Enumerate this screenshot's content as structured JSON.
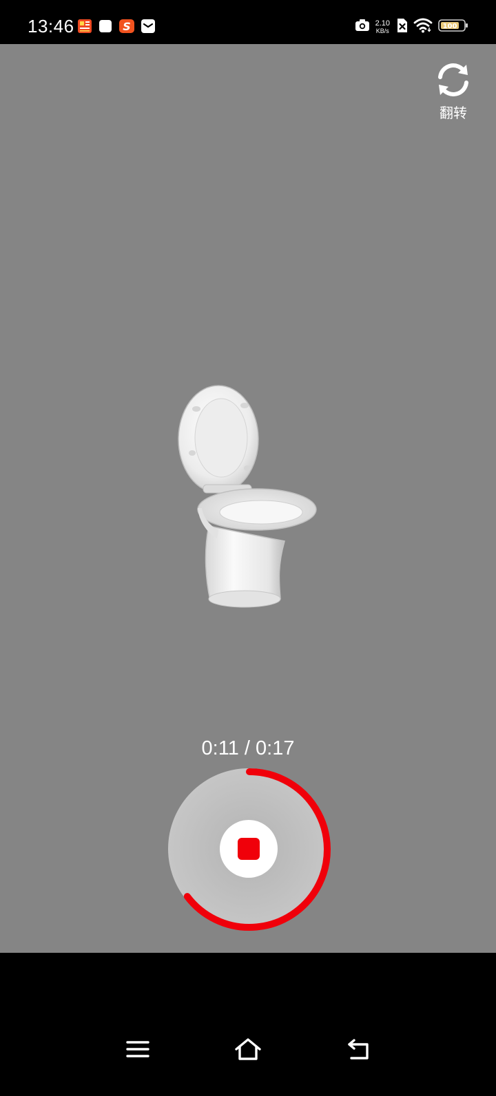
{
  "status_bar": {
    "time": "13:46",
    "net_speed_value": "2.10",
    "net_speed_unit": "KB/s",
    "notification_icons": [
      "news-app-icon",
      "white-app-icon",
      "sogou-input-icon",
      "mail-app-icon"
    ],
    "system_icons": [
      "camera-icon",
      "sim-off-icon",
      "wifi-icon",
      "battery-icon"
    ]
  },
  "camera": {
    "flip_label": "翻转",
    "subject": "toilet-image"
  },
  "recording": {
    "timer": "0:11 / 0:17",
    "elapsed_seconds": 11,
    "total_seconds": 17,
    "progress_color": "#f0000a",
    "stop_color": "#f0000a"
  },
  "navigation": {
    "buttons": [
      "menu-icon",
      "home-icon",
      "back-icon"
    ]
  }
}
